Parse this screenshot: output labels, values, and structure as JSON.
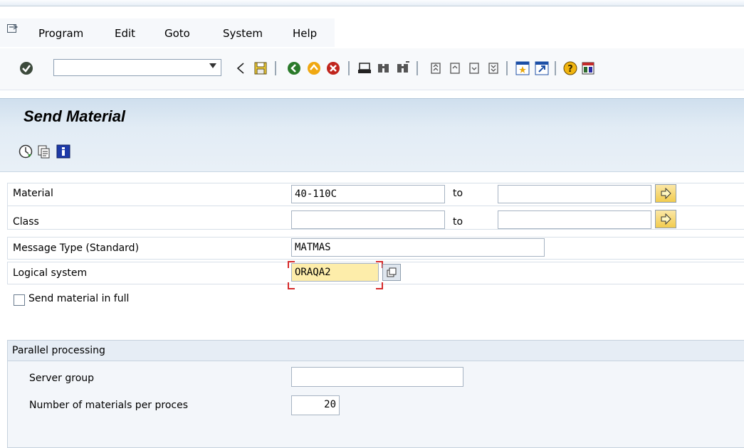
{
  "menubar": {
    "items": [
      "Program",
      "Edit",
      "Goto",
      "System",
      "Help"
    ]
  },
  "toolbar": {
    "command_field_value": "",
    "icons": [
      "enter-icon",
      "back-arrow-icon",
      "save-icon",
      "back-icon",
      "exit-icon",
      "cancel-icon",
      "print-icon",
      "find-icon",
      "find-next-icon",
      "first-page-icon",
      "previous-page-icon",
      "next-page-icon",
      "last-page-icon",
      "create-session-icon",
      "shortcut-icon",
      "help-icon",
      "layout-menu-icon"
    ]
  },
  "header": {
    "title": "Send Material",
    "app_icons": [
      "execute-icon",
      "variants-icon",
      "info-icon"
    ]
  },
  "form": {
    "material": {
      "label": "Material",
      "from": "40-110C",
      "to_label": "to",
      "to": ""
    },
    "class": {
      "label": "Class",
      "from": "",
      "to_label": "to",
      "to": ""
    },
    "message_type": {
      "label": "Message Type (Standard)",
      "value": "MATMAS"
    },
    "logical_system": {
      "label": "Logical system",
      "value": "ORAQA2"
    },
    "send_in_full": {
      "label": "Send material in full",
      "checked": false
    }
  },
  "parallel": {
    "title": "Parallel processing",
    "server_group": {
      "label": "Server group",
      "value": ""
    },
    "materials_per_process": {
      "label": "Number of materials per proces",
      "value": "20"
    }
  },
  "colors": {
    "header_bg": "#dce8f3",
    "required_field": "#fdedaa",
    "required_marker": "#d62b2b"
  }
}
